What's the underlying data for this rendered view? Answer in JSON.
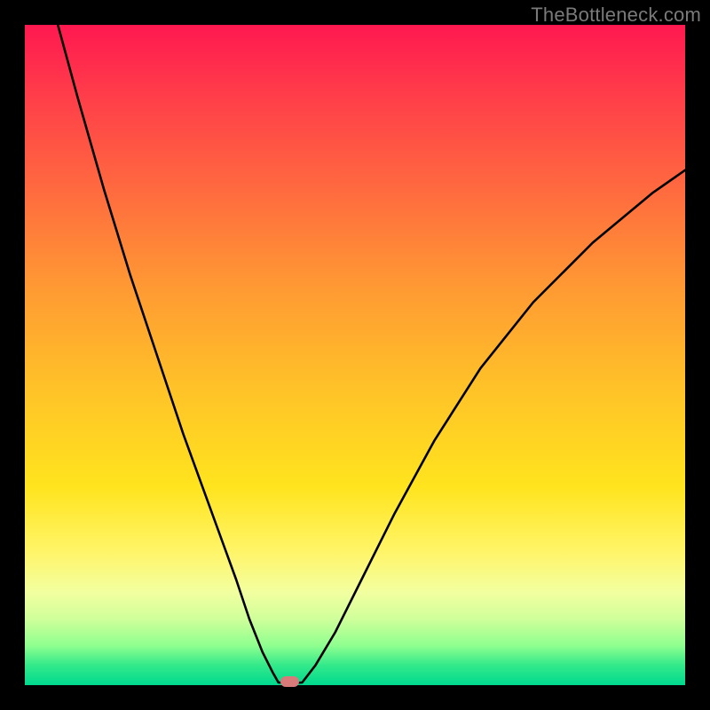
{
  "watermark": "TheBottleneck.com",
  "colors": {
    "frame": "#000000",
    "curve": "#000000",
    "blob": "#d97a7a",
    "gradient_stops": [
      "#ff1850",
      "#ff3b4a",
      "#ff6a3f",
      "#ff9a33",
      "#ffc228",
      "#ffe41e",
      "#fff56a",
      "#f2ffa0",
      "#cfff9a",
      "#8fff8f",
      "#33e98a",
      "#00d98f"
    ]
  },
  "chart_data": {
    "type": "line",
    "title": "",
    "xlabel": "",
    "ylabel": "",
    "xlim": [
      0,
      100
    ],
    "ylim": [
      0,
      100
    ],
    "note": "x and y are percentages of the plot area. (0,0) = top-left, (100,100) = bottom-right. Values estimated from pixels.",
    "series": [
      {
        "name": "left-branch",
        "description": "steep descending curve from top-left down to the valley",
        "x": [
          5,
          8,
          12,
          16,
          20,
          24,
          28,
          32,
          34,
          36,
          37.5,
          38.4
        ],
        "y": [
          0,
          11,
          25,
          38,
          50,
          62,
          73,
          84,
          90,
          95,
          98,
          99.6
        ]
      },
      {
        "name": "valley-floor",
        "description": "short near-horizontal segment at the bottom of the V",
        "x": [
          38.4,
          40.5,
          42.0
        ],
        "y": [
          99.6,
          99.7,
          99.6
        ]
      },
      {
        "name": "right-branch",
        "description": "curve rising from the valley toward upper-right, flattening as it goes",
        "x": [
          42.0,
          44,
          47,
          51,
          56,
          62,
          69,
          77,
          86,
          95,
          100
        ],
        "y": [
          99.6,
          97,
          92,
          84,
          74,
          63,
          52,
          42,
          33,
          25.5,
          22
        ]
      }
    ],
    "marker": {
      "name": "valley-blob",
      "x": 40.0,
      "y": 99.5,
      "shape": "rounded-rect",
      "color": "#d97a7a"
    }
  }
}
